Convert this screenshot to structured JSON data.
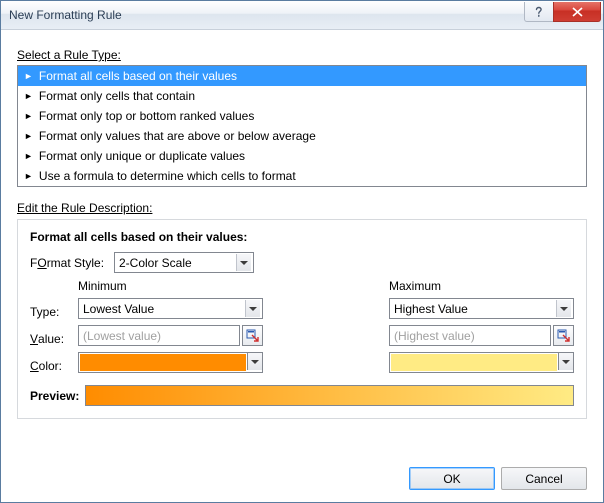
{
  "titlebar": {
    "title": "New Formatting Rule"
  },
  "section1_label_u": "S",
  "section1_label_rest": "elect a Rule Type:",
  "rule_types": [
    "Format all cells based on their values",
    "Format only cells that contain",
    "Format only top or bottom ranked values",
    "Format only values that are above or below average",
    "Format only unique or duplicate values",
    "Use a formula to determine which cells to format"
  ],
  "section2_label_u": "E",
  "section2_label_rest": "dit the Rule Description:",
  "desc": {
    "header": "Format all cells based on their values:",
    "format_style_u": "O",
    "format_style_pre": "F",
    "format_style_rest": "rmat Style:",
    "style_value": "2-Color Scale",
    "min_head": "Minimum",
    "max_head": "Maximum",
    "type_label": "Type:",
    "value_label_u": "V",
    "value_label_rest": "alue:",
    "color_label_u": "C",
    "color_label_rest": "olor:",
    "min_type": "Lowest Value",
    "max_type": "Highest Value",
    "min_value": "(Lowest value)",
    "max_value": "(Highest value)",
    "preview_label": "Preview:"
  },
  "colors": {
    "min": "#ff8c00",
    "max": "#ffeb84"
  },
  "buttons": {
    "ok": "OK",
    "cancel": "Cancel"
  }
}
